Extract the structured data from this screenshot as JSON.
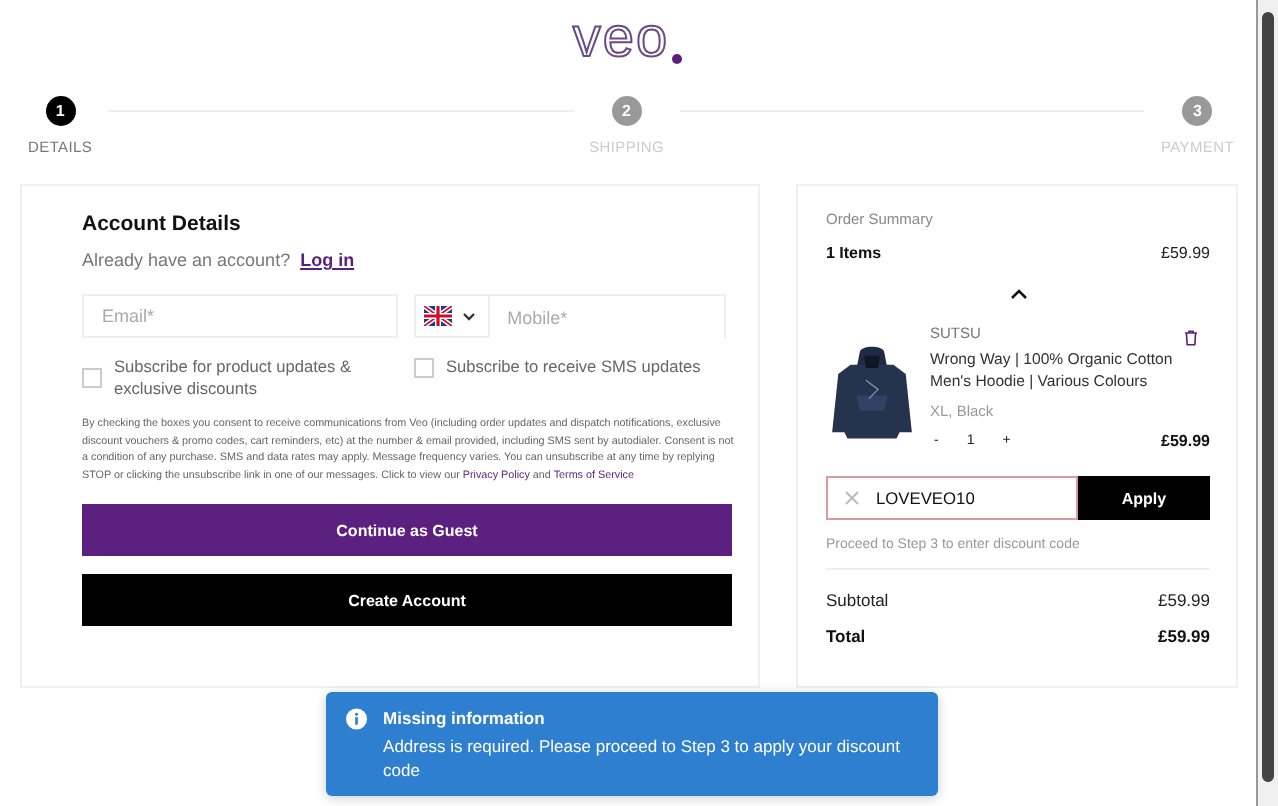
{
  "logo": "veo",
  "steps": [
    {
      "number": "1",
      "label": "DETAILS",
      "selected": true
    },
    {
      "number": "2",
      "label": "SHIPPING",
      "selected": false
    },
    {
      "number": "3",
      "label": "PAYMENT",
      "selected": false
    }
  ],
  "account": {
    "title": "Account Details",
    "login_prompt": "Already have an account?",
    "login_link": "Log in",
    "email": {
      "placeholder": "Email*"
    },
    "mobile": {
      "placeholder": "Mobile*"
    },
    "checkboxes": [
      {
        "label": "Subscribe for product updates & exclusive discounts",
        "checked": false
      },
      {
        "label": "Subscribe to receive SMS updates",
        "checked": false
      }
    ],
    "consent": "By checking the boxes you consent to receive communications from Veo (including order updates and dispatch notifications, exclusive discount vouchers & promo codes, cart reminders, etc) at the number & email provided, including SMS sent by autodialer. Consent is not a condition of any purchase. SMS and data rates may apply. Message frequency varies. You can unsubscribe at any time by replying STOP or clicking the unsubscribe link in one of our messages. Click to view our",
    "privacy_link": "Privacy Policy",
    "and": "and",
    "terms_link": "Terms of Service",
    "buttons": [
      {
        "label": "Continue as Guest",
        "kind": "primary"
      },
      {
        "label": "Create Account",
        "kind": "dark"
      }
    ]
  },
  "summary": {
    "title": "Order Summary",
    "items_count": "1 Items",
    "items_total": "£59.99",
    "item": {
      "brand": "SUTSU",
      "name": "Wrong Way | 100% Organic Cotton Men's Hoodie | Various Colours",
      "variant": "XL, Black",
      "minus": "-",
      "quantity": "1",
      "plus": "+",
      "price": "£59.99"
    },
    "discount": {
      "value": "LOVEVEO10",
      "button": "Apply",
      "hint": "Proceed to Step 3 to enter discount code"
    },
    "subtotal_label": "Subtotal",
    "subtotal": "£59.99",
    "total_label": "Total",
    "total": "£59.99"
  },
  "toast": {
    "title": "Missing information",
    "message": "Address is required. Please proceed to Step 3 to apply your discount code"
  }
}
